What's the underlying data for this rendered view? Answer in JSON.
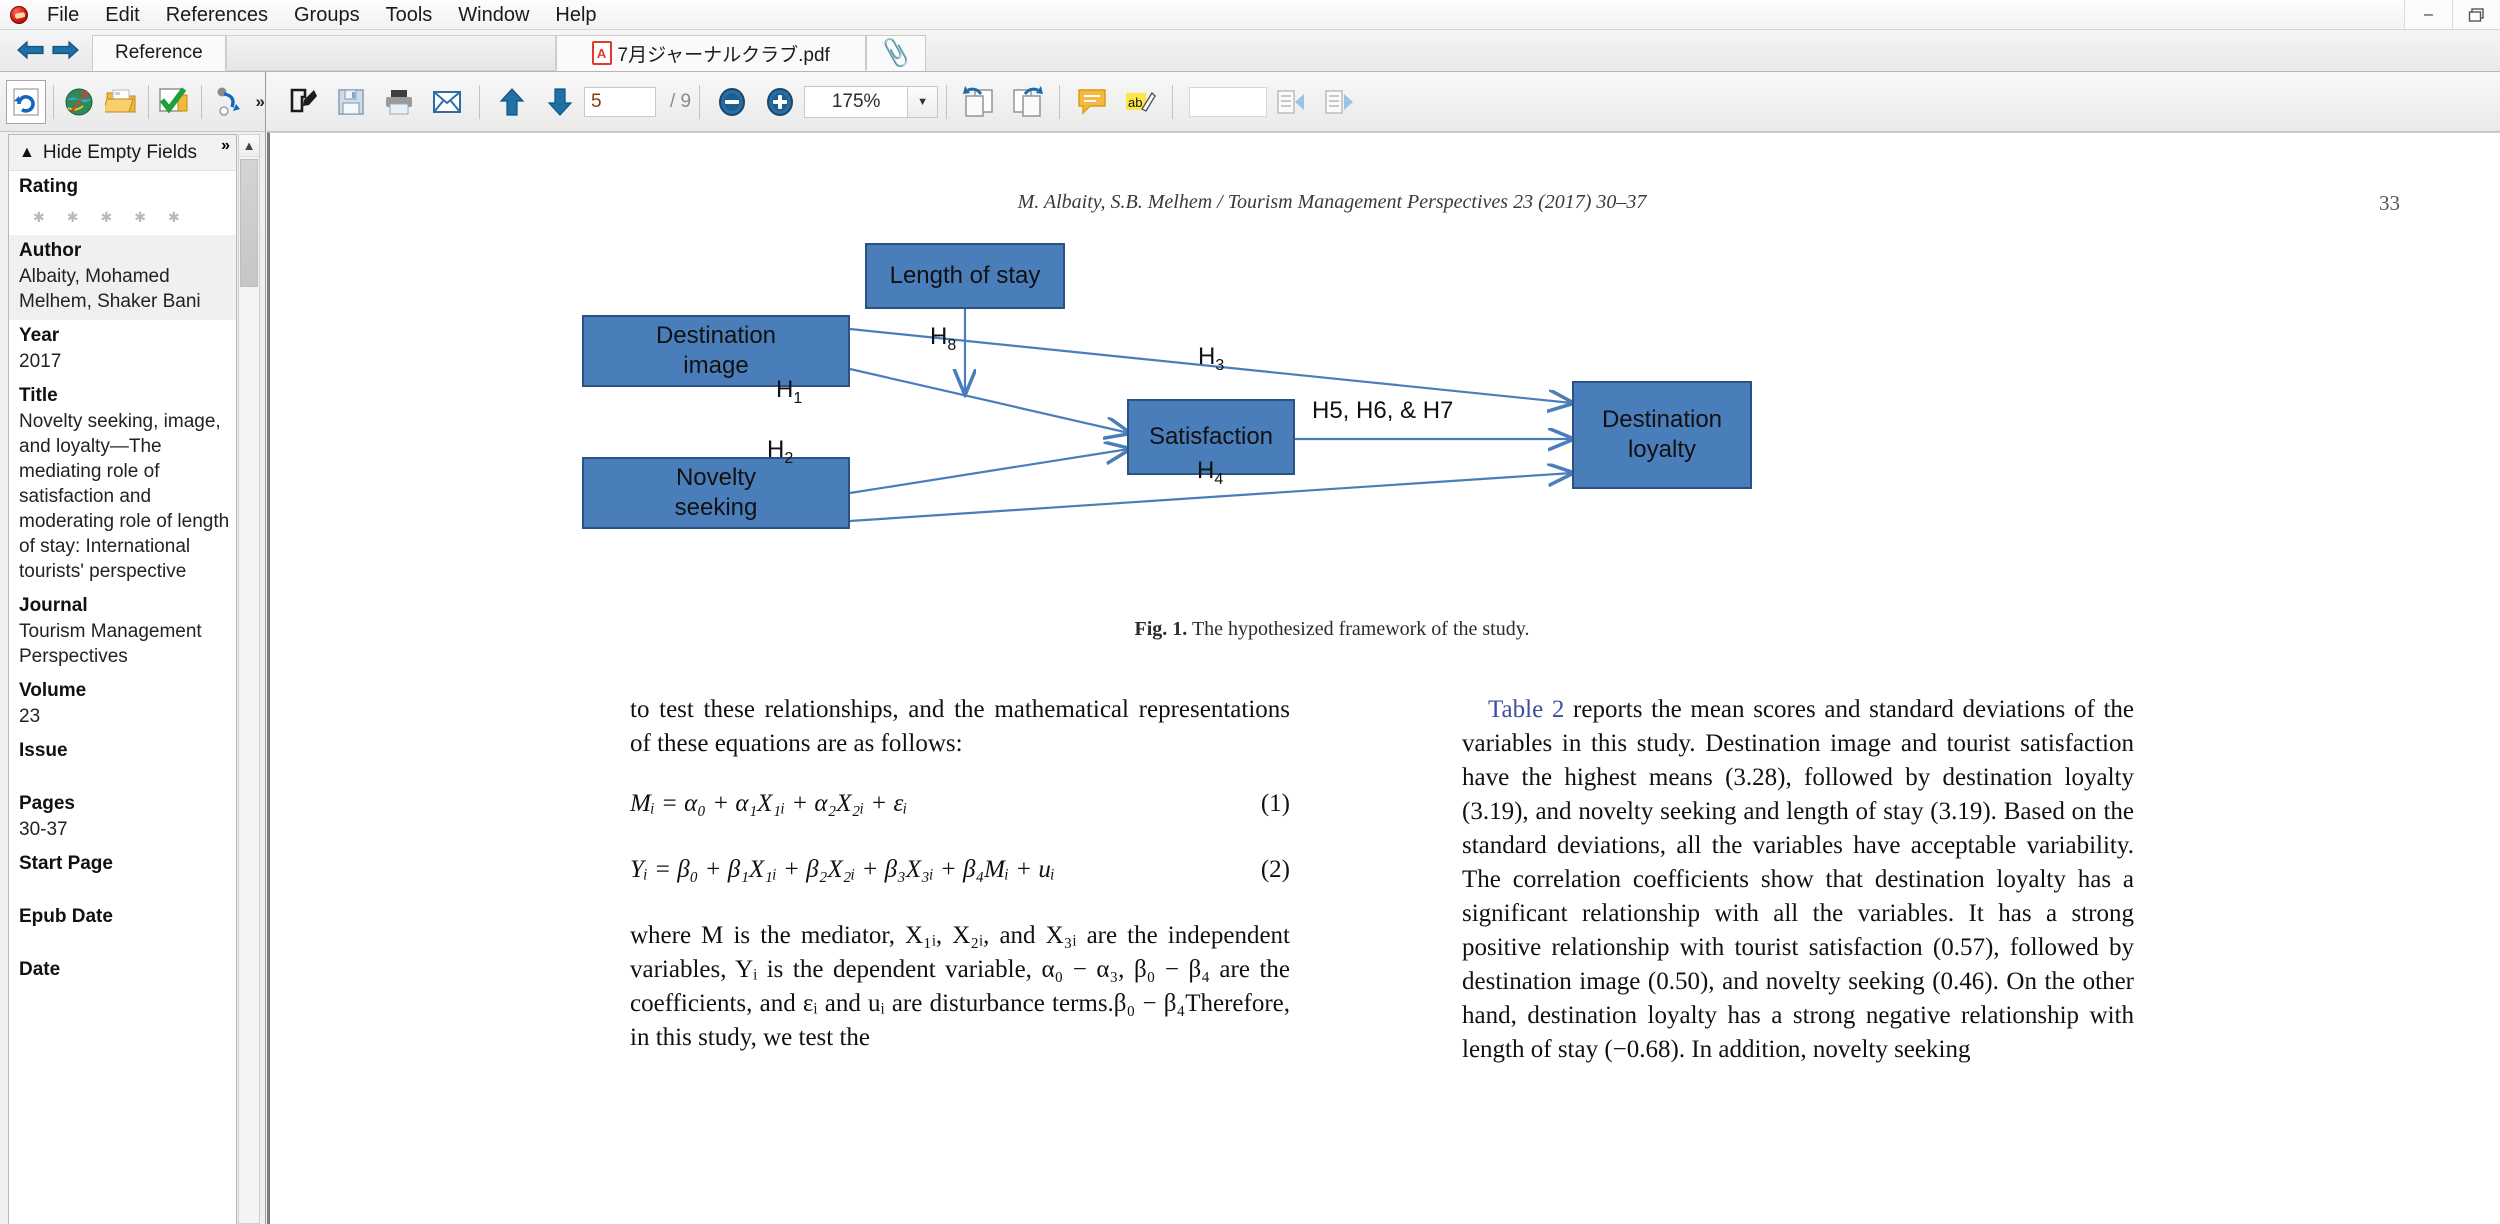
{
  "app": {
    "menu": [
      "File",
      "Edit",
      "References",
      "Groups",
      "Tools",
      "Window",
      "Help"
    ],
    "window_controls": {
      "minimize": "–",
      "restore": "❐"
    }
  },
  "tabs": {
    "reference_tab": "Reference",
    "pdf_tab": "7月ジャーナルクラブ.pdf",
    "pdf_badge": "A"
  },
  "left_toolbar": {
    "icons": [
      "sync-icon",
      "online-search-icon",
      "open-folder-icon",
      "find-full-text-icon",
      "share-icon"
    ],
    "overflow": "»"
  },
  "left_pane": {
    "hide_empty_fields": "Hide Empty Fields",
    "overflow": "»",
    "collapse_icon": "▲",
    "fields": [
      {
        "name": "Rating",
        "value": "",
        "type": "rating",
        "stars": 5
      },
      {
        "name": "Author",
        "value": "Albaity, Mohamed\nMelhem, Shaker Bani",
        "type": "text",
        "shaded": true
      },
      {
        "name": "Year",
        "value": "2017",
        "type": "text"
      },
      {
        "name": "Title",
        "value": "Novelty seeking, image, and loyalty—The mediating role of satisfaction and moderating role of length of stay: International tourists' perspective",
        "type": "text"
      },
      {
        "name": "Journal",
        "value": "Tourism Management Perspectives",
        "type": "text"
      },
      {
        "name": "Volume",
        "value": "23",
        "type": "text"
      },
      {
        "name": "Issue",
        "value": "",
        "type": "text"
      },
      {
        "name": "Pages",
        "value": "30-37",
        "type": "text"
      },
      {
        "name": "Start Page",
        "value": "",
        "type": "text"
      },
      {
        "name": "Epub Date",
        "value": "",
        "type": "text"
      },
      {
        "name": "Date",
        "value": "",
        "type": "text"
      }
    ]
  },
  "pdf_toolbar": {
    "icons": [
      "edit-icon",
      "save-icon",
      "print-icon",
      "email-icon",
      "prev-page-icon",
      "next-page-icon",
      "zoom-out-icon",
      "zoom-in-icon",
      "rotate-left-icon",
      "rotate-right-icon",
      "sticky-note-icon",
      "highlight-icon",
      "find-prev-icon",
      "find-next-icon"
    ],
    "current_page": "5",
    "page_total": "/ 9",
    "zoom_level": "175%",
    "zoom_dropdown": "▼",
    "search_value": "",
    "search_placeholder": ""
  },
  "document": {
    "running_head": "M. Albaity, S.B. Melhem / Tourism Management Perspectives 23 (2017) 30–37",
    "page_number": "33",
    "figure": {
      "caption_label": "Fig. 1.",
      "caption_text": " The hypothesized framework of the study.",
      "boxes": [
        {
          "id": "length-of-stay",
          "label": "Length of stay"
        },
        {
          "id": "destination-image",
          "label": "Destination\nimage"
        },
        {
          "id": "novelty-seeking",
          "label": "Novelty\nseeking"
        },
        {
          "id": "satisfaction",
          "label": "Satisfaction"
        },
        {
          "id": "destination-loyalty",
          "label": "Destination\nloyalty"
        }
      ],
      "hypothesis_labels": [
        {
          "id": "h8",
          "text": "H",
          "sub": "8"
        },
        {
          "id": "h1",
          "text": "H",
          "sub": "1"
        },
        {
          "id": "h2",
          "text": "H",
          "sub": "2"
        },
        {
          "id": "h3",
          "text": "H",
          "sub": "3"
        },
        {
          "id": "h4",
          "text": "H",
          "sub": "4"
        },
        {
          "id": "h567",
          "text": "H5, H6, & H7"
        }
      ]
    },
    "left_column": {
      "para1": "to test these relationships, and the mathematical representations of these equations are as follows:",
      "eq1": "Mᵢ = α₀ + α₁X₁ᵢ + α₂X₂ᵢ + εᵢ",
      "eq1_num": "(1)",
      "eq2": "Yᵢ = β₀ + β₁X₁ᵢ + β₂X₂ᵢ + β₃X₃ᵢ + β₄Mᵢ + uᵢ",
      "eq2_num": "(2)",
      "para2": "where M is the mediator, X₁ᵢ, X₂ᵢ, and X₃ᵢ are the independent variables, Yᵢ is the dependent variable, α₀ − α₃, β₀ − β₄ are the coefficients, and εᵢ and uᵢ are disturbance terms.β₀ − β₄Therefore, in this study, we test the"
    },
    "right_column": {
      "link_text": "Table 2",
      "para1": " reports the mean scores and standard deviations of the variables in this study. Destination image and tourist satisfaction have the highest means (3.28), followed by destination loyalty (3.19), and novelty seeking and length of stay (3.19). Based on the standard deviations, all the variables have acceptable variability. The correlation coefficients show that destination loyalty has a significant relationship with all the variables. It has a strong positive relationship with tourist satisfaction (0.57), followed by destination image (0.50), and novelty seeking (0.46). On the other hand, destination loyalty has a strong negative relationship with length of stay (−0.68). In addition, novelty seeking"
    }
  },
  "colors": {
    "box_fill": "#4a7ebb",
    "box_border": "#2c5284",
    "arrow": "#4a7ebb",
    "link": "#3b4fa0"
  }
}
